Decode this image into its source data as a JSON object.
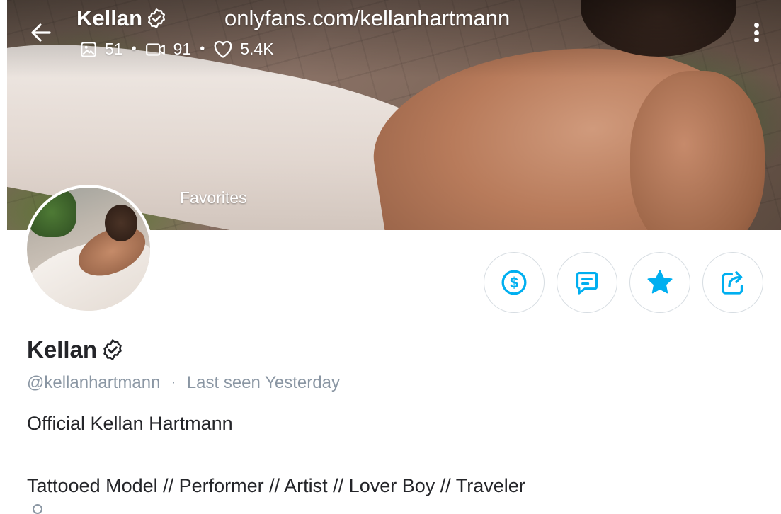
{
  "header": {
    "name": "Kellan",
    "url": "onlyfans.com/kellanhartmann",
    "stats": {
      "photos": "51",
      "videos": "91",
      "likes": "5.4K"
    }
  },
  "cover": {
    "label": "Favorites"
  },
  "profile": {
    "name": "Kellan",
    "username": "@kellanhartmann",
    "separator": "·",
    "last_seen": "Last seen Yesterday",
    "bio_lines": [
      "Official Kellan Hartmann",
      "Tattooed Model // Performer // Artist // Lover Boy // Traveler"
    ]
  },
  "actions": [
    {
      "name": "tip",
      "icon": "dollar-circle-icon"
    },
    {
      "name": "message",
      "icon": "message-icon"
    },
    {
      "name": "favorite",
      "icon": "star-icon"
    },
    {
      "name": "share",
      "icon": "share-icon"
    }
  ],
  "colors": {
    "accent": "#00aff0",
    "text": "#242529",
    "muted": "#8a96a3",
    "border": "#d7dde2"
  }
}
